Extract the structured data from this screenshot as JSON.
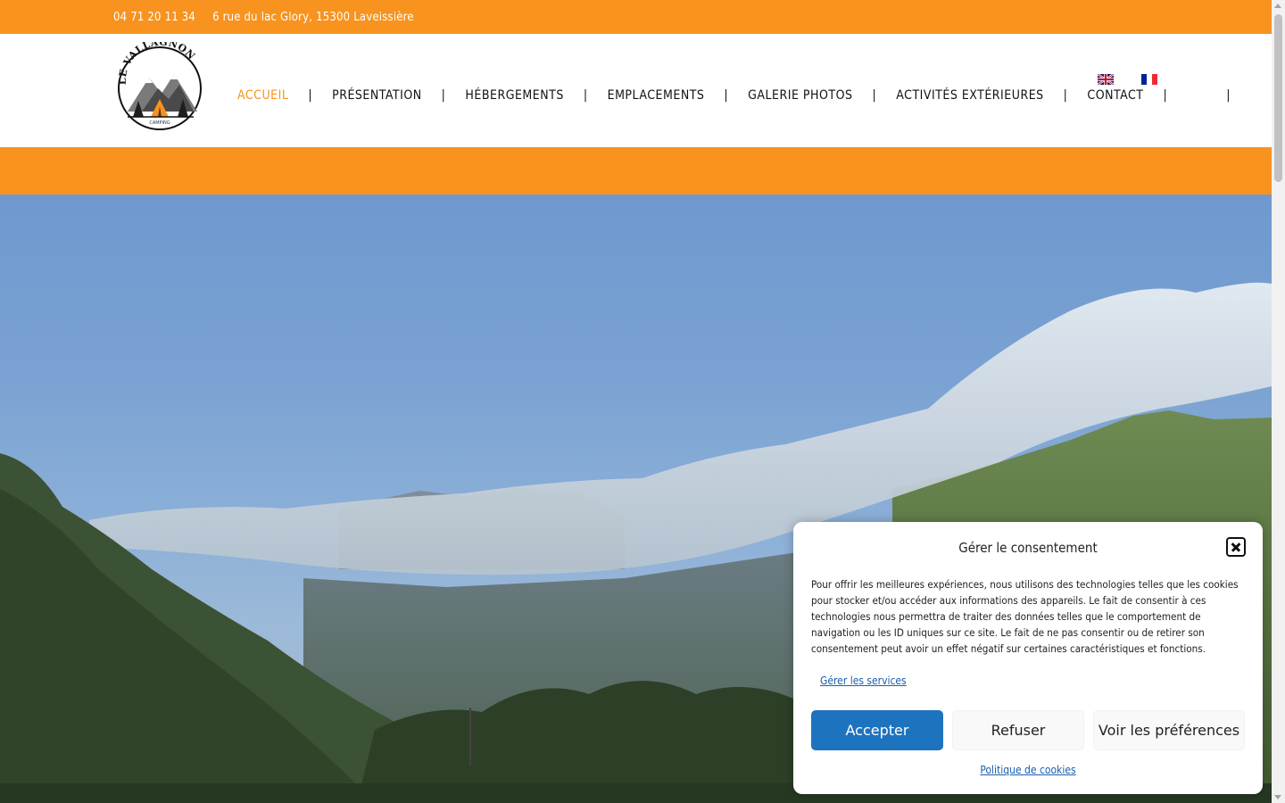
{
  "topbar": {
    "phone": "04 71 20 11 34",
    "address": "6 rue du lac Glory, 15300 Laveissière",
    "color": "#f7931e"
  },
  "logo": {
    "title": "LE VALLAGNON",
    "subtitle": "CAMPING"
  },
  "nav": {
    "items": [
      {
        "label": "ACCUEIL",
        "active": true
      },
      {
        "label": "PRÉSENTATION"
      },
      {
        "label": "HÉBERGEMENTS"
      },
      {
        "label": "EMPLACEMENTS"
      },
      {
        "label": "GALERIE PHOTOS"
      },
      {
        "label": "ACTIVITÉS EXTÉRIEURES"
      },
      {
        "label": "CONTACT"
      }
    ],
    "separator": "|",
    "languages": [
      "uk-flag-icon",
      "fr-flag-icon"
    ]
  },
  "consent": {
    "title": "Gérer le consentement",
    "text": "Pour offrir les meilleures expériences, nous utilisons des technologies telles que les cookies pour stocker et/ou accéder aux informations des appareils. Le fait de consentir à ces technologies nous permettra de traiter des données telles que le comportement de navigation ou les ID uniques sur ce site. Le fait de ne pas consentir ou de retirer son consentement peut avoir un effet négatif sur certaines caractéristiques et fonctions.",
    "manage_services": "Gérer les services",
    "accept": "Accepter",
    "refuse": "Refuser",
    "preferences": "Voir les préférences",
    "cookie_policy": "Politique de cookies",
    "accept_color": "#1e73be"
  }
}
